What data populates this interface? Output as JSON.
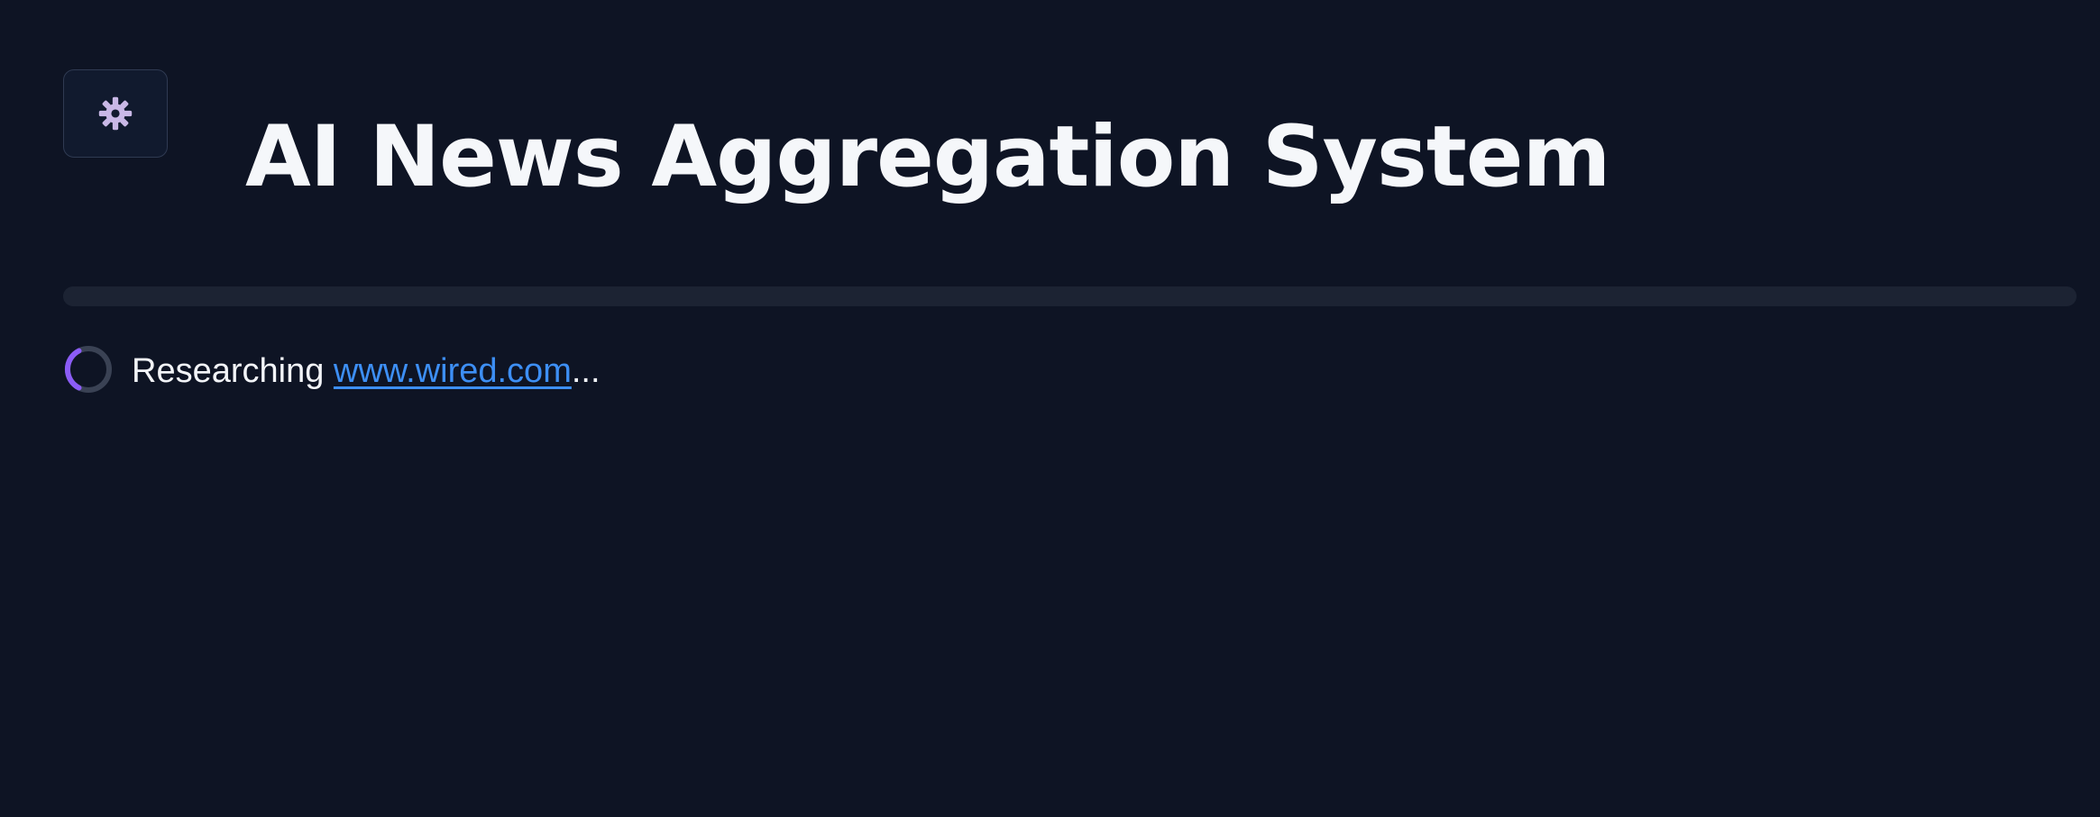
{
  "header": {
    "settings_icon": "gear-icon",
    "title": "AI News Aggregation System"
  },
  "progress": {
    "value": 0
  },
  "status": {
    "prefix": "Researching ",
    "link_text": "www.wired.com",
    "suffix": "..."
  },
  "colors": {
    "background": "#0e1424",
    "accent": "#8b5cf6",
    "link": "#3d8ff5",
    "gear": "#c9b8e6"
  }
}
